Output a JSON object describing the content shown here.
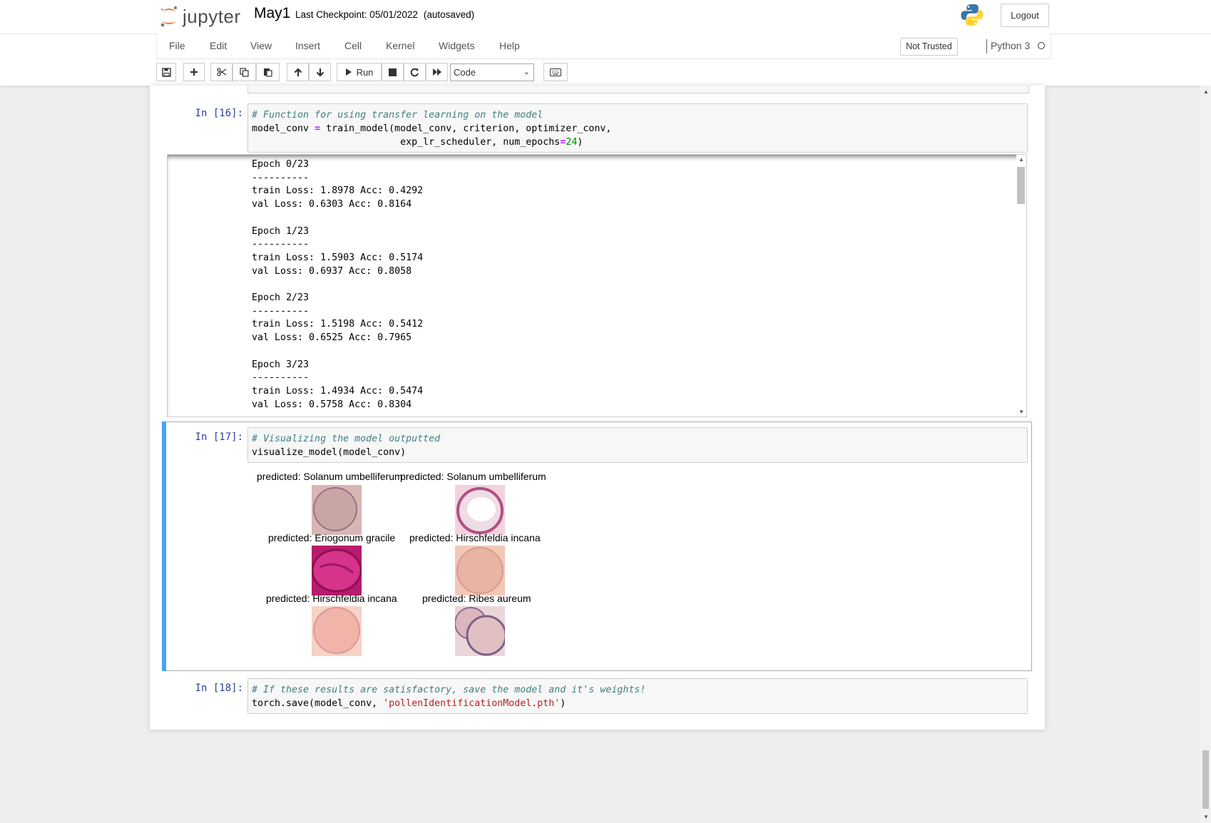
{
  "header": {
    "logo_text": "jupyter",
    "notebook_name": "May1",
    "checkpoint": "Last Checkpoint: 05/01/2022",
    "autosaved": "(autosaved)",
    "logout_label": "Logout"
  },
  "menubar": {
    "items": [
      "File",
      "Edit",
      "View",
      "Insert",
      "Cell",
      "Kernel",
      "Widgets",
      "Help"
    ],
    "trust_label": "Not Trusted",
    "kernel_name": "Python 3"
  },
  "toolbar": {
    "run_label": "Run",
    "cell_type": "Code"
  },
  "cells": [
    {
      "prompt": "In [16]:",
      "comment": "# Function for using transfer learning on the model",
      "code_line2_a": "model_conv ",
      "code_line2_op": "=",
      "code_line2_b": " train_model(model_conv, criterion, optimizer_conv,",
      "code_line3_a": "                          exp_lr_scheduler, num_epochs",
      "code_line3_op": "=",
      "code_line3_num": "24",
      "code_line3_b": ")",
      "output": "Epoch 0/23\n----------\ntrain Loss: 1.8978 Acc: 0.4292\nval Loss: 0.6303 Acc: 0.8164\n\nEpoch 1/23\n----------\ntrain Loss: 1.5903 Acc: 0.5174\nval Loss: 0.6937 Acc: 0.8058\n\nEpoch 2/23\n----------\ntrain Loss: 1.5198 Acc: 0.5412\nval Loss: 0.6525 Acc: 0.7965\n\nEpoch 3/23\n----------\ntrain Loss: 1.4934 Acc: 0.5474\nval Loss: 0.5758 Acc: 0.8304"
    },
    {
      "prompt": "In [17]:",
      "comment": "# Visualizing the model outputted",
      "code_line2": "visualize_model(model_conv)",
      "predictions": [
        {
          "label": "predicted: Solanum umbelliferum",
          "color": "#c9a6a3"
        },
        {
          "label": "predicted: Solanum umbelliferum",
          "color": "#f0d6df"
        },
        {
          "label": "predicted: Eriogonum gracile",
          "color": "#d6338a"
        },
        {
          "label": "predicted: Hirschfeldia incana",
          "color": "#e9b4a4"
        },
        {
          "label": "predicted: Hirschfeldia incana",
          "color": "#f1b4a8"
        },
        {
          "label": "predicted: Ribes aureum",
          "color": "#dbb6bd"
        }
      ]
    },
    {
      "prompt": "In [18]:",
      "comment": "# If these results are satisfactory, save the model and it's weights!",
      "code_line2_a": "torch.save(model_conv, ",
      "code_line2_str": "'pollenIdentificationModel.pth'",
      "code_line2_b": ")"
    }
  ],
  "colors": {
    "accent_selected": "#42a5f5",
    "prompt": "#303f9f",
    "jupyter_orange": "#f37726"
  }
}
